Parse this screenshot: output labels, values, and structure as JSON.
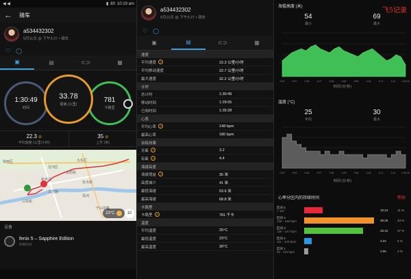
{
  "panel1": {
    "status": {
      "left": "◀ ◀",
      "time": "10:19 am",
      "battery": "80"
    },
    "appbar": {
      "back": "←",
      "title": "骑车"
    },
    "user": {
      "name": "a534432302",
      "sub": "5月11日 @ 下午3:27 • 骑车"
    },
    "actions": {
      "like": "♡",
      "comment": "◯"
    },
    "tabs": [
      "▣",
      "▤",
      "⊂⊃",
      "▦"
    ],
    "rings": [
      {
        "value": "1:30:49",
        "label": "时间",
        "color": "#4b5a78"
      },
      {
        "value": "33.78",
        "label": "距离 (公里)",
        "color": "#e89a2a"
      },
      {
        "value": "781",
        "label": "卡路里",
        "color": "#3fbf55"
      }
    ],
    "stats": [
      {
        "value": "22.3",
        "label": "平均速度 (公里/小时)"
      },
      {
        "value": "35",
        "label": "上升 (米)"
      }
    ],
    "map": {
      "labels": [
        "铁西区",
        "沈河区",
        "大东区",
        "太原街",
        "和平区",
        "文艺路",
        "浑河",
        "三好街",
        "长大街",
        "宁山中路"
      ],
      "temp": "23°C",
      "zoom": "10"
    },
    "device_section": "设备",
    "device": {
      "name": "fenix 5 – Sapphire Edition",
      "version": "3.40.0.0"
    }
  },
  "panel2": {
    "user": {
      "name": "a534432302",
      "sub": "5月11日 @ 下午3:27 • 骑车"
    },
    "sections": [
      {
        "title": "速度",
        "rows": [
          {
            "k": "平均速度",
            "v": "22.3 公里/小时",
            "badge": true
          },
          {
            "k": "平均移动速度",
            "v": "22.7 公里/小时",
            "badge": false
          },
          {
            "k": "最大速度",
            "v": "32.2 公里/小时",
            "badge": false
          }
        ]
      },
      {
        "title": "计时",
        "rows": [
          {
            "k": "总计时",
            "v": "1:30:49",
            "badge": false
          },
          {
            "k": "移动时间",
            "v": "1:29:05",
            "badge": false
          },
          {
            "k": "已用时间",
            "v": "1:35:28",
            "badge": false
          }
        ]
      },
      {
        "title": "心率",
        "rows": [
          {
            "k": "平均心率",
            "v": "148 bpm",
            "badge": true
          },
          {
            "k": "最高心率",
            "v": "180 bpm",
            "badge": false
          }
        ]
      },
      {
        "title": "训练效果",
        "rows": [
          {
            "k": "无氧",
            "v": "3.2",
            "badge": true
          },
          {
            "k": "有氧",
            "v": "4.4",
            "badge": true
          }
        ]
      },
      {
        "title": "海拔高度",
        "rows": [
          {
            "k": "海拔增益",
            "v": "35 米",
            "badge": true
          },
          {
            "k": "高度减少",
            "v": "41 米",
            "badge": false
          },
          {
            "k": "最低海拔",
            "v": "53.6 米",
            "badge": false
          },
          {
            "k": "最高海拔",
            "v": "68.8 米",
            "badge": false
          }
        ]
      },
      {
        "title": "卡路里",
        "rows": [
          {
            "k": "卡路里",
            "v": "781 千卡",
            "badge": true
          }
        ]
      },
      {
        "title": "温度",
        "rows": [
          {
            "k": "平均温度",
            "v": "25°C",
            "badge": false
          },
          {
            "k": "最低温度",
            "v": "23°C",
            "badge": false
          },
          {
            "k": "最高温度",
            "v": "30°C",
            "badge": false
          }
        ]
      }
    ]
  },
  "panel3": {
    "watermark": "飞5记录",
    "elevation": {
      "title": "海拔高度 (米)",
      "min": "54",
      "min_label": "最小",
      "max": "69",
      "max_label": "最大",
      "xlabel": "时间 (分:秒)"
    },
    "temperature": {
      "title": "温度 (°C)",
      "avg": "25",
      "avg_label": "平均",
      "max": "30",
      "max_label": "最大",
      "xlabel": "时间 (分:秒)"
    },
    "hr_zones": {
      "title": "心率分区内的持续时间",
      "help": "帮助",
      "zones": [
        {
          "name": "区间 5",
          "range": "> 167",
          "time": "10:24",
          "pct": "11 %",
          "color": "#e8273b",
          "frac": 0.26
        },
        {
          "name": "区间 4",
          "range": "148 - 166 bpm",
          "time": "39:28",
          "pct": "43 %",
          "color": "#f0912a",
          "frac": 0.98
        },
        {
          "name": "区间 3",
          "range": "130 - 147 bpm",
          "time": "33:15",
          "pct": "37 %",
          "color": "#52c23e",
          "frac": 0.83
        },
        {
          "name": "区间 2",
          "range": "111 - 129 bpm",
          "time": "4:24",
          "pct": "5 %",
          "color": "#2b97e0",
          "frac": 0.11
        },
        {
          "name": "区间 1",
          "range": "93 - 110 bpm",
          "time": "2:05",
          "pct": "2 %",
          "color": "#9a9a9a",
          "frac": 0.06
        }
      ]
    }
  },
  "chart_data": [
    {
      "type": "area",
      "title": "海拔高度 (米)",
      "xlabel": "时间 (分:秒)",
      "ylabel": "",
      "x": [
        "0:00",
        "0:27",
        "0:18",
        "0:27",
        "0:36",
        "0:45",
        "0:54",
        "1:03",
        "1:12",
        "1:21",
        "1:30:23"
      ],
      "ylim": [
        50,
        72
      ],
      "values": [
        58,
        60,
        62,
        63,
        64,
        63,
        65,
        66,
        64,
        63,
        62,
        64,
        65,
        63,
        62,
        61,
        60,
        62,
        63,
        64,
        62,
        60,
        58,
        59,
        61,
        60,
        56
      ]
    },
    {
      "type": "area",
      "title": "温度 (°C)",
      "xlabel": "时间 (分:秒)",
      "ylabel": "",
      "x": [
        "0:00",
        "0:09",
        "0:18",
        "0:27",
        "0:36",
        "0:45",
        "0:54",
        "1:03",
        "1:12",
        "1:21",
        "1:30:23"
      ],
      "ylim": [
        20,
        32
      ],
      "values": [
        29,
        30,
        28,
        27,
        26,
        25,
        25,
        25,
        24,
        25,
        24,
        24,
        25,
        24,
        24,
        24,
        24,
        23,
        24,
        24,
        24,
        24,
        23,
        24,
        25,
        24,
        24
      ]
    }
  ]
}
